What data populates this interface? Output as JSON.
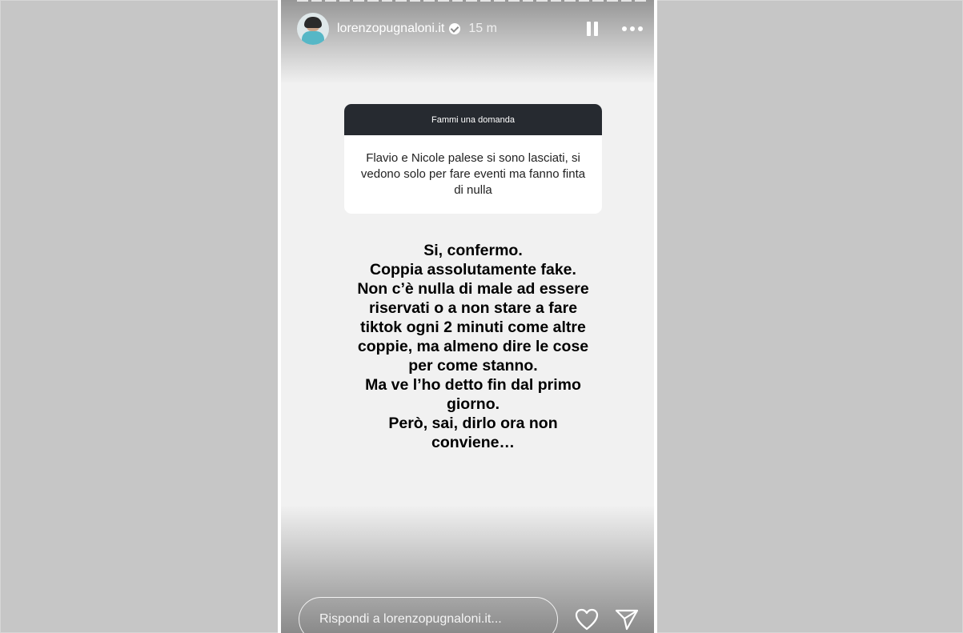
{
  "story": {
    "header": {
      "username": "lorenzopugnaloni.it",
      "time": "15 m",
      "verified": true
    },
    "question_box": {
      "title": "Fammi una domanda",
      "question": "Flavio e Nicole palese si sono lasciati, si vedono solo per fare eventi ma fanno finta di nulla"
    },
    "answer_lines": [
      "Si, confermo.",
      "Coppia assolutamente fake.",
      "Non c’è nulla di male ad essere",
      "riservati o a non stare a fare",
      "tiktok ogni 2 minuti come altre",
      "coppie, ma almeno dire le cose",
      "per come stanno.",
      "Ma ve l’ho detto fin dal primo",
      "giorno.",
      "Però, sai, dirlo ora non",
      "conviene…"
    ],
    "reply": {
      "placeholder": "Rispondi a lorenzopugnaloni.it..."
    },
    "icons": {
      "avatar": "avatar",
      "verified": "verified-badge-icon",
      "pause": "pause-icon",
      "more": "more-options-icon",
      "like": "heart-icon",
      "share": "send-icon"
    }
  }
}
